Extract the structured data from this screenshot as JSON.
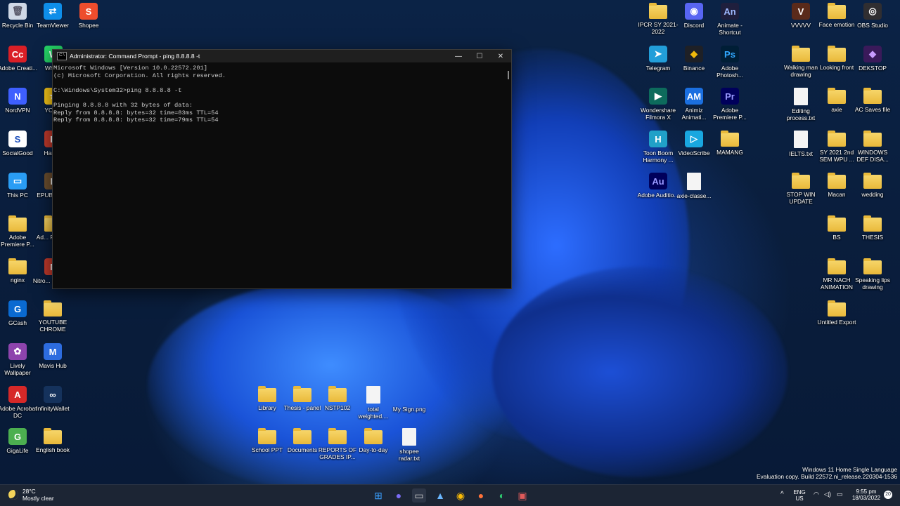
{
  "terminal": {
    "title": "Administrator: Command Prompt - ping  8.8.8.8 -t",
    "lines": [
      "Microsoft Windows [Version 10.0.22572.201]",
      "(c) Microsoft Corporation. All rights reserved.",
      "",
      "C:\\Windows\\System32>ping 8.8.8.8 -t",
      "",
      "Pinging 8.8.8.8 with 32 bytes of data:",
      "Reply from 8.8.8.8: bytes=32 time=83ms TTL=54",
      "Reply from 8.8.8.8: bytes=32 time=79ms TTL=54"
    ],
    "minimize": "—",
    "maximize": "☐",
    "close": "✕"
  },
  "desktop_icons": [
    {
      "label": "Recycle Bin",
      "kind": "bin",
      "color": "#cfd8e6"
    },
    {
      "label": "TeamViewer",
      "kind": "app",
      "color": "#0e8ee9",
      "glyph": "⇄"
    },
    {
      "label": "Shopee",
      "kind": "app",
      "color": "#ee4d2d",
      "glyph": "S"
    },
    {
      "label": "Adobe Creati...",
      "kind": "app",
      "color": "#da1f26",
      "glyph": "Cc"
    },
    {
      "label": "Wha...",
      "kind": "app",
      "color": "#25d366",
      "glyph": "W"
    },
    {
      "label": "NordVPN",
      "kind": "app",
      "color": "#3e5fff",
      "glyph": "N"
    },
    {
      "label": "YOU...",
      "kind": "app",
      "color": "#f5c518",
      "glyph": "★"
    },
    {
      "label": "SocialGood",
      "kind": "app",
      "color": "#ffffff",
      "glyph": "S",
      "fg": "#1a4dbb"
    },
    {
      "label": "Hand...",
      "kind": "app",
      "color": "#c0392b",
      "glyph": "H"
    },
    {
      "label": "This PC",
      "kind": "app",
      "color": "#2a9df4",
      "glyph": "▭"
    },
    {
      "label": "EPUB Rea...",
      "kind": "app",
      "color": "#6b4e2e",
      "glyph": "E"
    },
    {
      "label": "Adobe Premiere P...",
      "kind": "folder"
    },
    {
      "label": "Ad... Premi...",
      "kind": "folder"
    },
    {
      "label": "nginx",
      "kind": "folder"
    },
    {
      "label": "Nitro... Shortcut",
      "kind": "app",
      "color": "#c0392b",
      "glyph": "N"
    },
    {
      "label": "GCash",
      "kind": "app",
      "color": "#0a6ad1",
      "glyph": "G"
    },
    {
      "label": "YOUTUBE CHROME",
      "kind": "folder"
    },
    {
      "label": "Lively Wallpaper",
      "kind": "app",
      "color": "#8e44ad",
      "glyph": "✿"
    },
    {
      "label": "Mavis Hub",
      "kind": "app",
      "color": "#2d6cdf",
      "glyph": "M"
    },
    {
      "label": "Adobe Acrobat DC",
      "kind": "app",
      "color": "#d62828",
      "glyph": "A"
    },
    {
      "label": "InfinityWallet",
      "kind": "app",
      "color": "#15325c",
      "glyph": "∞"
    },
    {
      "label": "GigaLife",
      "kind": "app",
      "color": "#4caf50",
      "glyph": "G"
    },
    {
      "label": "English book",
      "kind": "folder"
    },
    {
      "label": "IPCR SY 2021-2022",
      "kind": "folder"
    },
    {
      "label": "Discord",
      "kind": "app",
      "color": "#5865f2",
      "glyph": "◉"
    },
    {
      "label": "Animate - Shortcut",
      "kind": "app",
      "color": "#1f1f3d",
      "glyph": "An",
      "fg": "#9fb9ff"
    },
    {
      "label": "Telegram",
      "kind": "app",
      "color": "#229ed9",
      "glyph": "➤"
    },
    {
      "label": "Binance",
      "kind": "app",
      "color": "#1e2026",
      "glyph": "◆",
      "fg": "#f0b90b"
    },
    {
      "label": "Adobe Photosh...",
      "kind": "app",
      "color": "#001e36",
      "glyph": "Ps",
      "fg": "#31a8ff"
    },
    {
      "label": "Wondershare Filmora X",
      "kind": "app",
      "color": "#0d6b5c",
      "glyph": "▶"
    },
    {
      "label": "Animiz Animati...",
      "kind": "app",
      "color": "#1b6fe0",
      "glyph": "AM"
    },
    {
      "label": "Adobe Premiere P...",
      "kind": "app",
      "color": "#00005b",
      "glyph": "Pr",
      "fg": "#9999ff"
    },
    {
      "label": "Toon Boom Harmony ...",
      "kind": "app",
      "color": "#20a0c8",
      "glyph": "H"
    },
    {
      "label": "VideoScribe",
      "kind": "app",
      "color": "#19a7e0",
      "glyph": "▷"
    },
    {
      "label": "MAMANG",
      "kind": "folder"
    },
    {
      "label": "Adobe Auditio...",
      "kind": "app",
      "color": "#00005b",
      "glyph": "Au",
      "fg": "#9999ff"
    },
    {
      "label": "axie-classe...",
      "kind": "doc"
    },
    {
      "label": "VVVVV",
      "kind": "app",
      "color": "#5a2a1a",
      "glyph": "V"
    },
    {
      "label": "Face emotion",
      "kind": "folder"
    },
    {
      "label": "OBS Studio",
      "kind": "app",
      "color": "#302e31",
      "glyph": "◎"
    },
    {
      "label": "Walking man drawing",
      "kind": "folder"
    },
    {
      "label": "Looking front",
      "kind": "folder"
    },
    {
      "label": "DEKSTOP",
      "kind": "app",
      "color": "#3a1a5a",
      "glyph": "◆",
      "fg": "#c89bff"
    },
    {
      "label": "Editing process.txt",
      "kind": "doc"
    },
    {
      "label": "axie",
      "kind": "folder"
    },
    {
      "label": "AC Saves file",
      "kind": "folder"
    },
    {
      "label": "IELTS.txt",
      "kind": "doc"
    },
    {
      "label": "SY 2021 2nd SEM WPU ...",
      "kind": "folder"
    },
    {
      "label": "WINDOWS DEF DISA...",
      "kind": "folder"
    },
    {
      "label": "STOP WIN UPDATE",
      "kind": "folder"
    },
    {
      "label": "Macan",
      "kind": "folder"
    },
    {
      "label": "wedding",
      "kind": "folder"
    },
    {
      "label": "BS",
      "kind": "folder"
    },
    {
      "label": "THESIS",
      "kind": "folder"
    },
    {
      "label": "MR NACH ANIMATION",
      "kind": "folder"
    },
    {
      "label": "Speaking lips drawing",
      "kind": "folder"
    },
    {
      "label": "Untitled Export",
      "kind": "folder"
    },
    {
      "label": "Library",
      "kind": "folder"
    },
    {
      "label": "Thesis - panel",
      "kind": "folder"
    },
    {
      "label": "NSTP102",
      "kind": "folder"
    },
    {
      "label": "total weighted....",
      "kind": "doc"
    },
    {
      "label": "My Sign.png",
      "kind": "blank"
    },
    {
      "label": "School PPT",
      "kind": "folder"
    },
    {
      "label": "Documents",
      "kind": "folder"
    },
    {
      "label": "REPORTS OF GRADES IP...",
      "kind": "folder"
    },
    {
      "label": "Day-to-day",
      "kind": "folder"
    },
    {
      "label": "shopee radar.txt",
      "kind": "doc"
    }
  ],
  "watermark": {
    "line1": "Windows 11 Home Single Language",
    "line2": "Evaluation copy. Build 22572.ni_release.220304-1536"
  },
  "taskbar": {
    "weather_temp": "28°C",
    "weather_desc": "Mostly clear",
    "lang_top": "ENG",
    "lang_bottom": "US",
    "time": "9:55 pm",
    "date": "18/03/2022",
    "notif_count": "20",
    "apps": [
      {
        "name": "start-button",
        "glyph": "⊞",
        "color": "#3aa0ff"
      },
      {
        "name": "chat-taskbar-icon",
        "glyph": "●",
        "color": "#7b6cf6"
      },
      {
        "name": "terminal-taskbar-icon",
        "glyph": "▭",
        "color": "#cfcfcf"
      },
      {
        "name": "photos-taskbar-icon",
        "glyph": "▲",
        "color": "#6ab7ff"
      },
      {
        "name": "chrome-taskbar-icon",
        "glyph": "◉",
        "color": "#fbbc05"
      },
      {
        "name": "firefox-taskbar-icon",
        "glyph": "●",
        "color": "#ff7139"
      },
      {
        "name": "edge-taskbar-icon",
        "glyph": "◐",
        "color": "#2ecc71"
      },
      {
        "name": "app-taskbar-icon",
        "glyph": "▣",
        "color": "#e05a5a"
      }
    ]
  }
}
